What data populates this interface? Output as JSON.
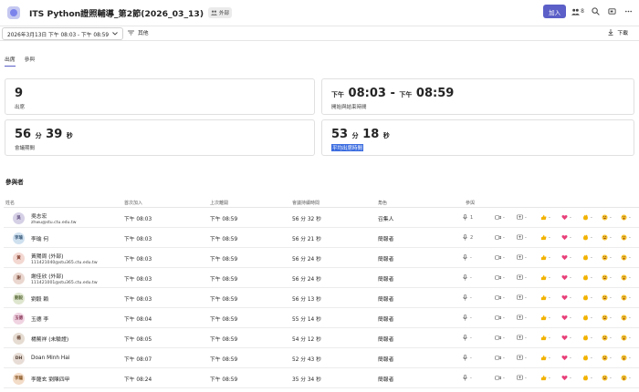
{
  "header": {
    "title": "ITS Python證照輔導_第2節(2026_03_13)",
    "external_badge": "外部",
    "join_label": "加入",
    "participant_count": "8"
  },
  "filter": {
    "date_range": "2026年3月13日 下午 08:03 - 下午 08:59",
    "filter_label": "其他",
    "download_label": "下載"
  },
  "tabs": [
    {
      "label": "出席",
      "active": true
    },
    {
      "label": "參與",
      "active": false
    }
  ],
  "summary": {
    "attendees": {
      "value": "9",
      "label": "出席"
    },
    "time": {
      "start_prefix": "下午",
      "start": "08:03",
      "sep": "-",
      "end_prefix": "下午",
      "end": "08:59",
      "label": "開始與結束時間"
    },
    "duration": {
      "min": "56",
      "min_unit": "分",
      "sec": "39",
      "sec_unit": "秒",
      "label": "會議期間"
    },
    "avg": {
      "min": "53",
      "min_unit": "分",
      "sec": "18",
      "sec_unit": "秒",
      "label": "平均出席時間"
    }
  },
  "participants_title": "參與者",
  "columns": {
    "name": "姓名",
    "first_join": "首次加入",
    "last_leave": "上次離開",
    "duration": "會議持續時間",
    "role": "角色",
    "engagement": "參與"
  },
  "colors": {
    "accent": "#5b5fc7",
    "highlight": "#3d6ee0"
  },
  "rows": [
    {
      "initials": "吳",
      "name": "吳志宏",
      "email": "zhwu@stu.ctu.edu.tw",
      "first": "下午 08:03",
      "last": "下午 08:59",
      "dur": "56 分 32 秒",
      "role": "召集人",
      "mic": "1",
      "cam": "",
      "av_bg": "#d6d0e6",
      "av_fg": "#5a4a7a"
    },
    {
      "initials": "李瑜",
      "name": "李瑜 何",
      "email": "",
      "first": "下午 08:03",
      "last": "下午 08:59",
      "dur": "56 分 21 秒",
      "role": "簡報者",
      "mic": "2",
      "cam": "",
      "av_bg": "#cfe0ef",
      "av_fg": "#3a5a7a"
    },
    {
      "initials": "黃",
      "name": "黃陽周 (外部)",
      "email": "111421040@stu365.ctu.edu.tw",
      "first": "下午 08:03",
      "last": "下午 08:59",
      "dur": "56 分 24 秒",
      "role": "簡報者",
      "mic": "",
      "cam": "",
      "av_bg": "#f3d8d2",
      "av_fg": "#8a4a3a"
    },
    {
      "initials": "謝",
      "name": "謝佳欣 (外部)",
      "email": "111421001@stu365.ctu.edu.tw",
      "first": "下午 08:03",
      "last": "下午 08:59",
      "dur": "56 分 24 秒",
      "role": "簡報者",
      "mic": "",
      "cam": "",
      "av_bg": "#ead7cf",
      "av_fg": "#7a4a3a"
    },
    {
      "initials": "劉毅",
      "name": "劉毅 賴",
      "email": "",
      "first": "下午 08:03",
      "last": "下午 08:59",
      "dur": "56 分 13 秒",
      "role": "簡報者",
      "mic": "",
      "cam": "",
      "av_bg": "#dfe6cf",
      "av_fg": "#5a6a3a"
    },
    {
      "initials": "玉德",
      "name": "玉德 李",
      "email": "",
      "first": "下午 08:04",
      "last": "下午 08:59",
      "dur": "55 分 14 秒",
      "role": "簡報者",
      "mic": "",
      "cam": "",
      "av_bg": "#f0d4e2",
      "av_fg": "#8a3a5a"
    },
    {
      "initials": "楊",
      "name": "楊鰲祥 (未驗證)",
      "email": "",
      "first": "下午 08:05",
      "last": "下午 08:59",
      "dur": "54 分 12 秒",
      "role": "簡報者",
      "mic": "",
      "cam": "",
      "av_bg": "#e6dcd2",
      "av_fg": "#6a4a3a"
    },
    {
      "initials": "DH",
      "name": "Doan Minh Hai",
      "email": "",
      "first": "下午 08:07",
      "last": "下午 08:59",
      "dur": "52 分 43 秒",
      "role": "簡報者",
      "mic": "",
      "cam": "",
      "av_bg": "#e8ddd6",
      "av_fg": "#4a3a30"
    },
    {
      "initials": "李薩",
      "name": "李薩玄 劉陳四甲",
      "email": "",
      "first": "下午 08:24",
      "last": "下午 08:59",
      "dur": "35 分 34 秒",
      "role": "簡報者",
      "mic": "",
      "cam": "",
      "av_bg": "#f3dcc8",
      "av_fg": "#8a5a2a"
    }
  ],
  "engagement_icons": [
    "mic-icon",
    "camera-icon",
    "share-icon",
    "like-icon",
    "heart-icon",
    "clap-icon",
    "laugh-icon",
    "surprised-icon",
    "hand-raise-icon"
  ],
  "dash": "-"
}
